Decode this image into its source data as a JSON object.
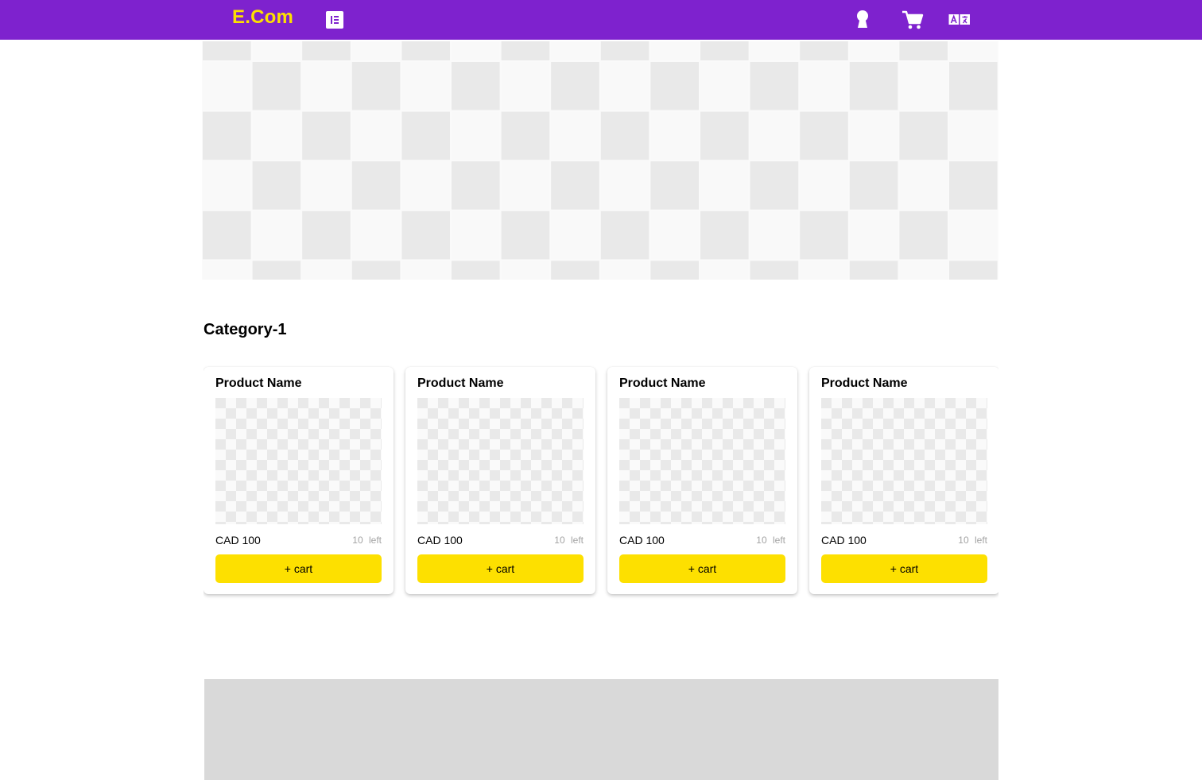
{
  "header": {
    "logo": "E.Com",
    "background_color": "#7e22ce",
    "logo_color": "#fde000",
    "menu_icon": "list-menu-icon",
    "actions": [
      {
        "name": "account",
        "icon": "keyhole-user-icon"
      },
      {
        "name": "cart",
        "icon": "shopping-cart-icon"
      },
      {
        "name": "language",
        "icon": "translate-icon"
      }
    ]
  },
  "hero": {
    "image": "placeholder-checkerboard"
  },
  "category": {
    "title": "Category-1",
    "products": [
      {
        "name": "Product Name",
        "price": "CAD 100",
        "stock": "10 left",
        "button": "+ cart"
      },
      {
        "name": "Product Name",
        "price": "CAD 100",
        "stock": "10 left",
        "button": "+ cart"
      },
      {
        "name": "Product Name",
        "price": "CAD 100",
        "stock": "10 left",
        "button": "+ cart"
      },
      {
        "name": "Product Name",
        "price": "CAD 100",
        "stock": "10 left",
        "button": "+ cart"
      }
    ]
  },
  "colors": {
    "accent": "#fde000",
    "brand": "#7e22ce",
    "footer": "#d9d9d9",
    "stock_text": "#a3a3a3"
  }
}
